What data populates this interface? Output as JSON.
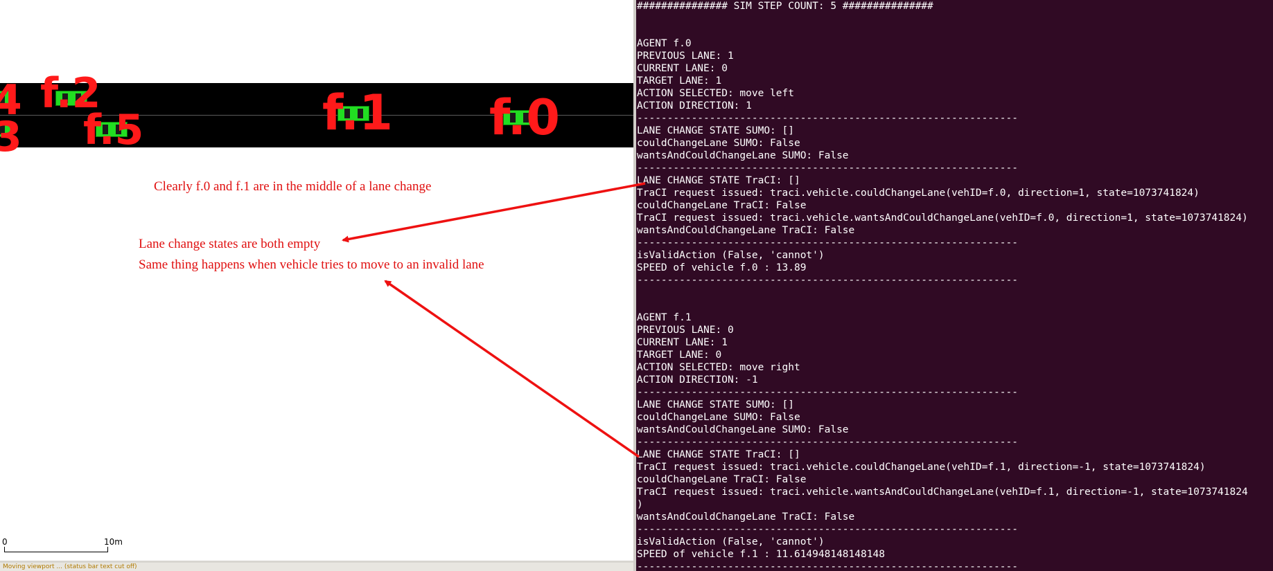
{
  "vehicles": [
    {
      "id": "f.0"
    },
    {
      "id": "f.1"
    },
    {
      "id": "f.2"
    },
    {
      "id": "f.5"
    },
    {
      "id": "4"
    },
    {
      "id": "3"
    }
  ],
  "annotations": {
    "note1": "Clearly f.0 and f.1 are in the middle of a lane change",
    "note2": "Lane change states are both empty",
    "note3": "Same thing happens when vehicle tries to move to an invalid lane"
  },
  "scale": {
    "start": "0",
    "end": "10m"
  },
  "status_bar": "Moving viewport ... (status bar text cut off)",
  "colors": {
    "terminal_bg": "#300a24",
    "annotation": "#e01010",
    "vehicle": "#22dd22",
    "road": "#000000"
  },
  "terminal_lines": [
    "############### SIM STEP COUNT: 5 ###############",
    "",
    "",
    "AGENT f.0",
    "PREVIOUS LANE: 1",
    "CURRENT LANE: 0",
    "TARGET LANE: 1",
    "ACTION SELECTED: move left",
    "ACTION DIRECTION: 1",
    "---------------------------------------------------------------",
    "LANE CHANGE STATE SUMO: []",
    "couldChangeLane SUMO: False",
    "wantsAndCouldChangeLane SUMO: False",
    "---------------------------------------------------------------",
    "LANE CHANGE STATE TraCI: []",
    "TraCI request issued: traci.vehicle.couldChangeLane(vehID=f.0, direction=1, state=1073741824)",
    "couldChangeLane TraCI: False",
    "TraCI request issued: traci.vehicle.wantsAndCouldChangeLane(vehID=f.0, direction=1, state=1073741824)",
    "wantsAndCouldChangeLane TraCI: False",
    "---------------------------------------------------------------",
    "isValidAction (False, 'cannot')",
    "SPEED of vehicle f.0 : 13.89",
    "---------------------------------------------------------------",
    "",
    "",
    "AGENT f.1",
    "PREVIOUS LANE: 0",
    "CURRENT LANE: 1",
    "TARGET LANE: 0",
    "ACTION SELECTED: move right",
    "ACTION DIRECTION: -1",
    "---------------------------------------------------------------",
    "LANE CHANGE STATE SUMO: []",
    "couldChangeLane SUMO: False",
    "wantsAndCouldChangeLane SUMO: False",
    "---------------------------------------------------------------",
    "LANE CHANGE STATE TraCI: []",
    "TraCI request issued: traci.vehicle.couldChangeLane(vehID=f.1, direction=-1, state=1073741824)",
    "couldChangeLane TraCI: False",
    "TraCI request issued: traci.vehicle.wantsAndCouldChangeLane(vehID=f.1, direction=-1, state=1073741824",
    ")",
    "wantsAndCouldChangeLane TraCI: False",
    "---------------------------------------------------------------",
    "isValidAction (False, 'cannot')",
    "SPEED of vehicle f.1 : 11.614948148148148",
    "---------------------------------------------------------------"
  ]
}
